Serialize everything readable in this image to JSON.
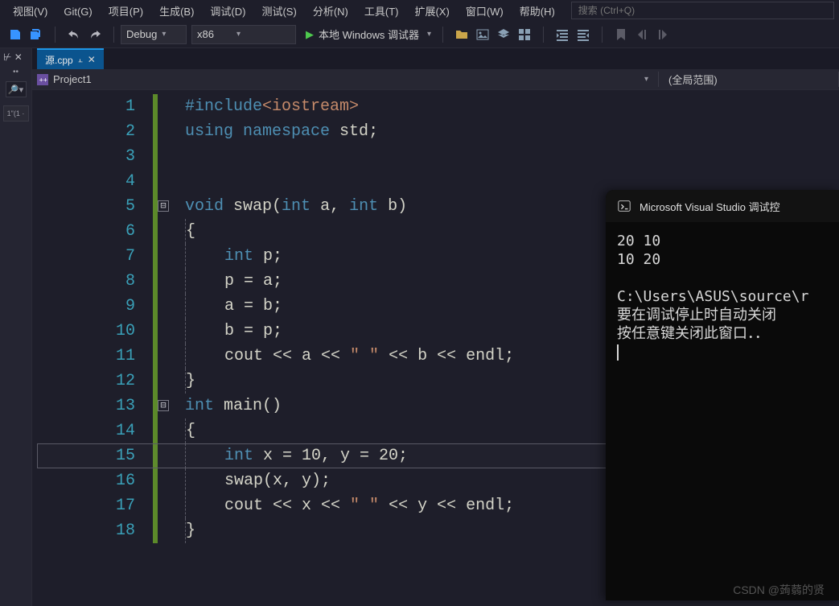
{
  "menu": {
    "items": [
      "视图(V)",
      "Git(G)",
      "项目(P)",
      "生成(B)",
      "调试(D)",
      "测试(S)",
      "分析(N)",
      "工具(T)",
      "扩展(X)",
      "窗口(W)",
      "帮助(H)"
    ],
    "search_placeholder": "搜索 (Ctrl+Q)"
  },
  "toolbar": {
    "config": "Debug",
    "platform": "x86",
    "run_label": "本地 Windows 调试器"
  },
  "tab": {
    "name": "源.cpp"
  },
  "nav": {
    "project": "Project1",
    "scope": "(全局范围)"
  },
  "left_rail": {
    "thumb_label": "1\"(1 ·"
  },
  "editor": {
    "line_count": 18,
    "highlight_line": 15,
    "fold_markers": [
      {
        "line": 5,
        "symbol": "-"
      },
      {
        "line": 13,
        "symbol": "-"
      }
    ],
    "lines": [
      [
        {
          "t": "#include",
          "c": "kw"
        },
        {
          "t": "<iostream>",
          "c": "str"
        }
      ],
      [
        {
          "t": "using ",
          "c": "kw"
        },
        {
          "t": "namespace ",
          "c": "kw"
        },
        {
          "t": "std",
          "c": "nm"
        },
        {
          "t": ";",
          "c": "nm"
        }
      ],
      [],
      [],
      [
        {
          "t": "void ",
          "c": "kw"
        },
        {
          "t": "swap",
          "c": "nm"
        },
        {
          "t": "(",
          "c": "nm"
        },
        {
          "t": "int ",
          "c": "kw"
        },
        {
          "t": "a",
          "c": "nm"
        },
        {
          "t": ", ",
          "c": "nm"
        },
        {
          "t": "int ",
          "c": "kw"
        },
        {
          "t": "b",
          "c": "nm"
        },
        {
          "t": ")",
          "c": "nm"
        }
      ],
      [
        {
          "t": "{",
          "c": "nm"
        }
      ],
      [
        {
          "t": "    ",
          "c": "nm"
        },
        {
          "t": "int ",
          "c": "kw"
        },
        {
          "t": "p;",
          "c": "nm"
        }
      ],
      [
        {
          "t": "    p = a;",
          "c": "nm"
        }
      ],
      [
        {
          "t": "    a = b;",
          "c": "nm"
        }
      ],
      [
        {
          "t": "    b = p;",
          "c": "nm"
        }
      ],
      [
        {
          "t": "    cout << a << ",
          "c": "nm"
        },
        {
          "t": "\" \"",
          "c": "str"
        },
        {
          "t": " << b << endl;",
          "c": "nm"
        }
      ],
      [
        {
          "t": "}",
          "c": "nm"
        }
      ],
      [
        {
          "t": "int ",
          "c": "kw"
        },
        {
          "t": "main",
          "c": "nm"
        },
        {
          "t": "()",
          "c": "nm"
        }
      ],
      [
        {
          "t": "{",
          "c": "nm"
        }
      ],
      [
        {
          "t": "    ",
          "c": "nm"
        },
        {
          "t": "int ",
          "c": "kw"
        },
        {
          "t": "x = 10, y = 20;",
          "c": "nm"
        }
      ],
      [
        {
          "t": "    swap(x, y);",
          "c": "nm"
        }
      ],
      [
        {
          "t": "    cout << x << ",
          "c": "nm"
        },
        {
          "t": "\" \"",
          "c": "str"
        },
        {
          "t": " << y << endl;",
          "c": "nm"
        }
      ],
      [
        {
          "t": "}",
          "c": "nm"
        }
      ]
    ],
    "indent_guides": [
      0,
      0,
      0,
      0,
      0,
      1,
      1,
      1,
      1,
      1,
      1,
      1,
      0,
      1,
      1,
      1,
      1,
      1
    ]
  },
  "console": {
    "title": "Microsoft Visual Studio 调试控",
    "lines": [
      "20 10",
      "10 20",
      "",
      "C:\\Users\\ASUS\\source\\r",
      "要在调试停止时自动关闭",
      "按任意键关闭此窗口．．"
    ]
  },
  "watermark": "CSDN @蒟蒻的贤"
}
